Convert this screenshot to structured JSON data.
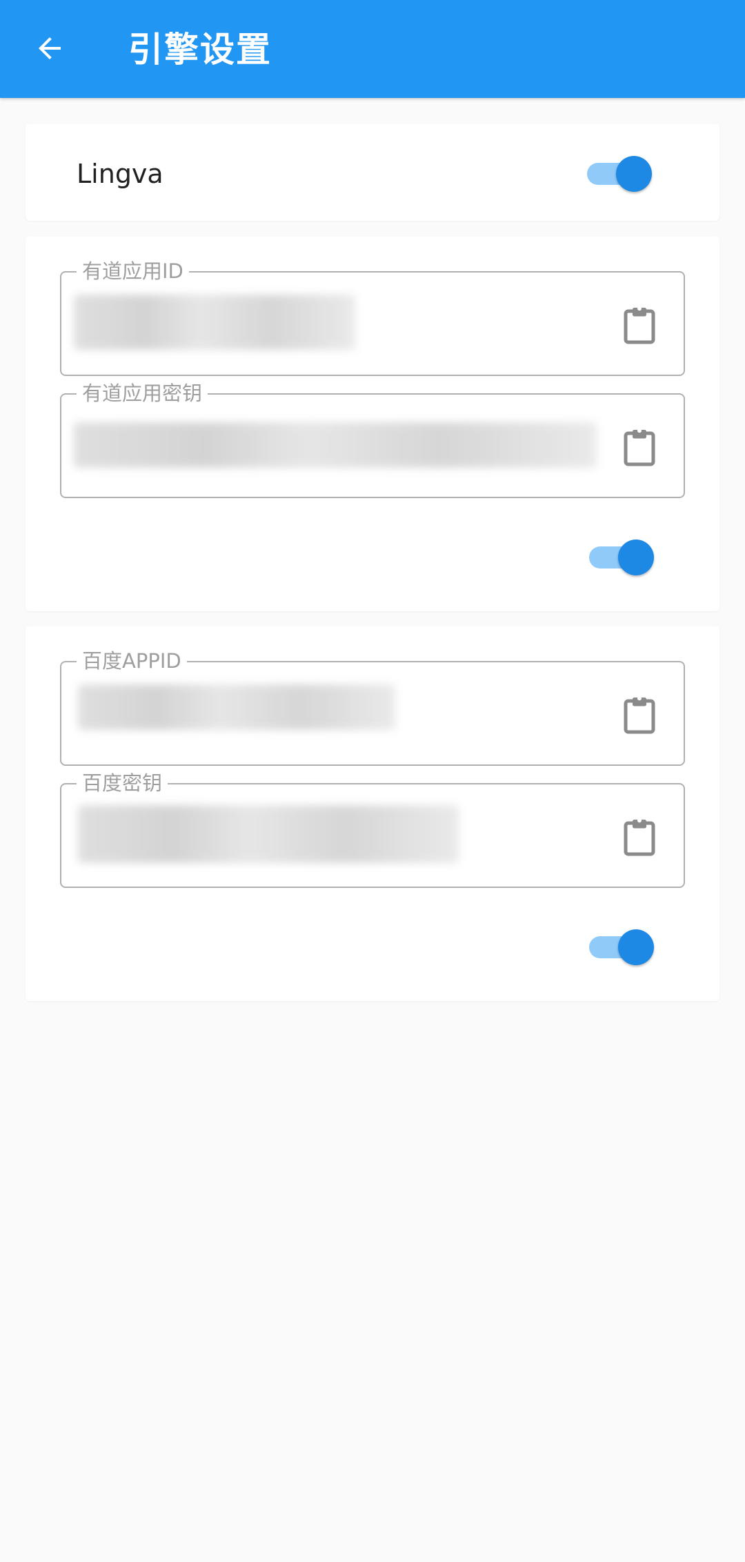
{
  "appbar": {
    "title": "引擎设置",
    "back_icon": "arrow-back-icon"
  },
  "lingva": {
    "label": "Lingva",
    "enabled": true
  },
  "youdao": {
    "app_id_label": "有道应用ID",
    "app_id_value": "",
    "app_key_label": "有道应用密钥",
    "app_key_value": "",
    "enabled": true,
    "paste_icon": "clipboard-icon"
  },
  "baidu": {
    "app_id_label": "百度APPID",
    "app_id_value": "",
    "key_label": "百度密钥",
    "key_value": "",
    "enabled": true,
    "paste_icon": "clipboard-icon"
  },
  "colors": {
    "primary": "#2196f3",
    "switch_thumb": "#1e88e5",
    "switch_track": "#90caf9",
    "background": "#fafafa"
  }
}
